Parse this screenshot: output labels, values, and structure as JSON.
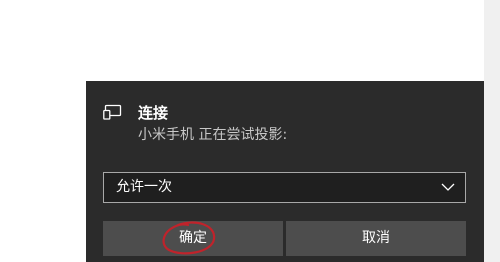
{
  "dialog": {
    "title": "连接",
    "message": "小米手机 正在尝试投影:",
    "select": {
      "value": "允许一次"
    },
    "buttons": {
      "ok": "确定",
      "cancel": "取消"
    }
  },
  "icons": {
    "header": "cast-device-icon",
    "dropdown": "chevron-down-icon"
  },
  "annotation": {
    "color": "#c0232b"
  }
}
